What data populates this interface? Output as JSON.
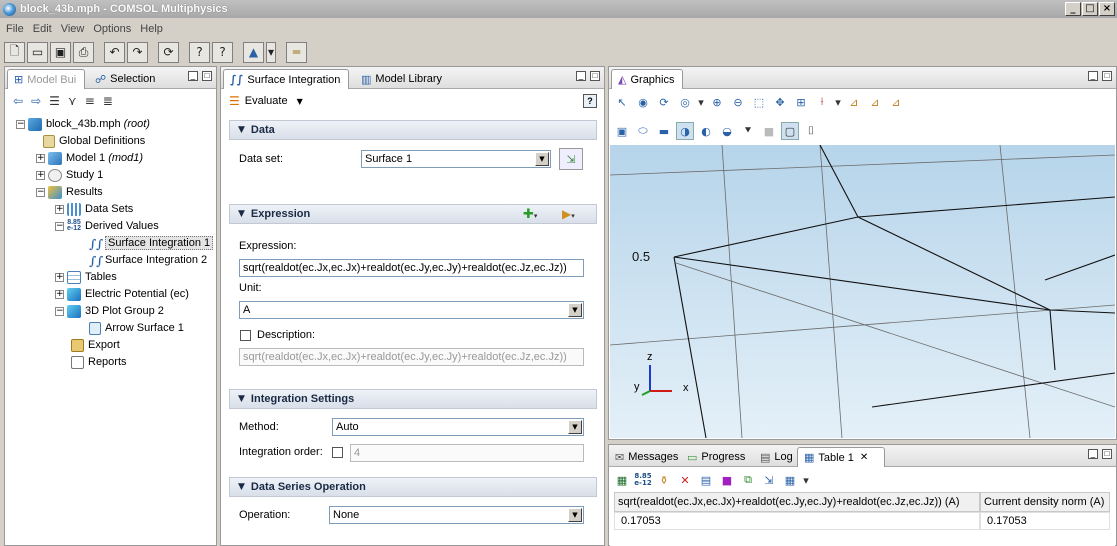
{
  "window": {
    "title": "block_43b.mph - COMSOL Multiphysics"
  },
  "menu": [
    "File",
    "Edit",
    "View",
    "Options",
    "Help"
  ],
  "model_builder": {
    "tabs": [
      {
        "label": "Model Bui"
      },
      {
        "label": "Selection"
      }
    ],
    "tree": [
      {
        "label": "block_43b.mph",
        "suffix": "(root)"
      },
      {
        "label": "Global Definitions"
      },
      {
        "label": "Model 1",
        "suffix": "(mod1)"
      },
      {
        "label": "Study 1"
      },
      {
        "label": "Results"
      },
      {
        "label": "Data Sets"
      },
      {
        "label": "Derived Values"
      },
      {
        "label": "Surface Integration 1"
      },
      {
        "label": "Surface Integration 2"
      },
      {
        "label": "Tables"
      },
      {
        "label": "Electric Potential (ec)"
      },
      {
        "label": "3D Plot Group 2"
      },
      {
        "label": "Arrow Surface 1"
      },
      {
        "label": "Export"
      },
      {
        "label": "Reports"
      }
    ],
    "derived_badge": {
      "top": "8.85",
      "bottom": "e-12"
    }
  },
  "settings": {
    "tabs": [
      {
        "label": "Surface Integration"
      },
      {
        "label": "Model Library"
      }
    ],
    "evaluate_label": "Evaluate",
    "sections": {
      "data": "Data",
      "expression": "Expression",
      "integration": "Integration Settings",
      "series": "Data Series Operation"
    },
    "data_set_label": "Data set:",
    "data_set_value": "Surface 1",
    "expression_label": "Expression:",
    "expression_value": "sqrt(realdot(ec.Jx,ec.Jx)+realdot(ec.Jy,ec.Jy)+realdot(ec.Jz,ec.Jz))",
    "unit_label": "Unit:",
    "unit_value": "A",
    "description_label": "Description:",
    "description_value": "sqrt(realdot(ec.Jx,ec.Jx)+realdot(ec.Jy,ec.Jy)+realdot(ec.Jz,ec.Jz))",
    "method_label": "Method:",
    "method_value": "Auto",
    "order_label": "Integration order:",
    "order_value": "4",
    "operation_label": "Operation:",
    "operation_value": "None"
  },
  "graphics": {
    "tab": "Graphics",
    "axis_value": "0.5",
    "axes": {
      "z": "z",
      "y": "y",
      "x": "x"
    }
  },
  "bottom": {
    "tabs": [
      {
        "label": "Messages"
      },
      {
        "label": "Progress"
      },
      {
        "label": "Log"
      },
      {
        "label": "Table 1"
      }
    ],
    "badge": {
      "top": "8.85",
      "bottom": "e-12"
    },
    "headers": [
      "sqrt(realdot(ec.Jx,ec.Jx)+realdot(ec.Jy,ec.Jy)+realdot(ec.Jz,ec.Jz)) (A)",
      "Current density norm (A)"
    ],
    "rows": [
      [
        "0.17053",
        "0.17053"
      ]
    ]
  }
}
